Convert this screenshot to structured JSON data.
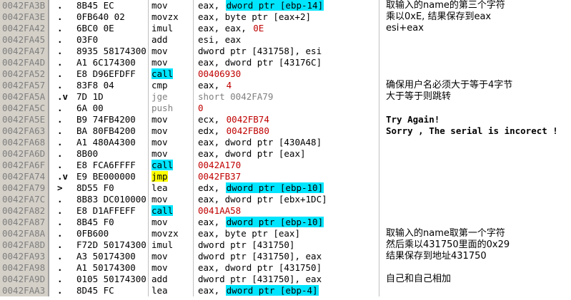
{
  "rows": [
    {
      "addr": "0042FA3B",
      "mark": ".",
      "bytes": "8B45 EC",
      "mnem": "mov",
      "op_pre": "eax, ",
      "op_hl": "dword ptr [ebp-14]",
      "op_post": "",
      "comment": "取输入的name的第三个字符"
    },
    {
      "addr": "0042FA3E",
      "mark": ".",
      "bytes": "0FB640 02",
      "mnem": "movzx",
      "op_pre": "eax, byte ptr [eax+2]",
      "op_hl": "",
      "op_post": "",
      "comment": "乘以0xE, 结果保存到eax"
    },
    {
      "addr": "0042FA42",
      "mark": ".",
      "bytes": "6BC0 0E",
      "mnem": "imul",
      "op_pre": "eax, eax, ",
      "op_red": "0E",
      "comment": "esi+eax"
    },
    {
      "addr": "0042FA45",
      "mark": ".",
      "bytes": "03F0",
      "mnem": "add",
      "op_pre": "esi, eax",
      "comment": ""
    },
    {
      "addr": "0042FA47",
      "mark": ".",
      "bytes": "8935 58174300",
      "mnem": "mov",
      "op_pre": "dword ptr [431758], esi",
      "comment": ""
    },
    {
      "addr": "0042FA4D",
      "mark": ".",
      "bytes": "A1 6C174300",
      "mnem": "mov",
      "op_pre": "eax, dword ptr [43176C]",
      "comment": ""
    },
    {
      "addr": "0042FA52",
      "mark": ".",
      "bytes": "E8 D96EFDFF",
      "mnem": "call",
      "mnem_hl": "cyan",
      "op_red": "00406930",
      "comment": ""
    },
    {
      "addr": "0042FA57",
      "mark": ".",
      "bytes": "83F8 04",
      "mnem": "cmp",
      "op_pre": "eax, ",
      "op_red": "4",
      "comment": "确保用户名必须大于等于4字节"
    },
    {
      "addr": "0042FA5A",
      "mark": ".v",
      "bytes": "7D 1D",
      "mnem": "jge",
      "gray": true,
      "op_pre": "short 0042FA79",
      "comment": "大于等于则跳转"
    },
    {
      "addr": "0042FA5C",
      "mark": ".",
      "bytes": "6A 00",
      "mnem": "push",
      "gray": true,
      "op_red": "0",
      "comment": ""
    },
    {
      "addr": "0042FA5E",
      "mark": ".",
      "bytes": "B9 74FB4200",
      "mnem": "mov",
      "op_pre": "ecx, ",
      "op_red": "0042FB74",
      "comment": "Try Again!",
      "mono": true
    },
    {
      "addr": "0042FA63",
      "mark": ".",
      "bytes": "BA 80FB4200",
      "mnem": "mov",
      "op_pre": "edx, ",
      "op_red": "0042FB80",
      "comment": "Sorry , The serial is incorect !",
      "mono": true
    },
    {
      "addr": "0042FA68",
      "mark": ".",
      "bytes": "A1 480A4300",
      "mnem": "mov",
      "op_pre": "eax, dword ptr [430A48]",
      "comment": ""
    },
    {
      "addr": "0042FA6D",
      "mark": ".",
      "bytes": "8B00",
      "mnem": "mov",
      "op_pre": "eax, dword ptr [eax]",
      "comment": ""
    },
    {
      "addr": "0042FA6F",
      "mark": ".",
      "bytes": "E8 FCA6FFFF",
      "mnem": "call",
      "mnem_hl": "cyan",
      "op_red": "0042A170",
      "comment": ""
    },
    {
      "addr": "0042FA74",
      "mark": ".v",
      "bytes": "E9 BE000000",
      "mnem": "jmp",
      "mnem_hl": "yellow",
      "op_red": "0042FB37",
      "comment": ""
    },
    {
      "addr": "0042FA79",
      "mark": ">",
      "bytes": "8D55 F0",
      "mnem": "lea",
      "op_pre": "edx, ",
      "op_hl": "dword ptr [ebp-10]",
      "comment": ""
    },
    {
      "addr": "0042FA7C",
      "mark": ".",
      "bytes": "8B83 DC010000",
      "mnem": "mov",
      "op_pre": "eax, dword ptr [ebx+1DC]",
      "comment": ""
    },
    {
      "addr": "0042FA82",
      "mark": ".",
      "bytes": "E8 D1AFFEFF",
      "mnem": "call",
      "mnem_hl": "cyan",
      "op_red": "0041AA58",
      "comment": ""
    },
    {
      "addr": "0042FA87",
      "mark": ".",
      "bytes": "8B45 F0",
      "mnem": "mov",
      "op_pre": "eax, ",
      "op_hl": "dword ptr [ebp-10]",
      "comment": ""
    },
    {
      "addr": "0042FA8A",
      "mark": ".",
      "bytes": "0FB600",
      "mnem": "movzx",
      "op_pre": "eax, byte ptr [eax]",
      "comment": "取输入的name取第一个字符"
    },
    {
      "addr": "0042FA8D",
      "mark": ".",
      "bytes": "F72D 50174300",
      "mnem": "imul",
      "op_pre": "dword ptr [431750]",
      "comment": "然后乘以431750里面的0x29"
    },
    {
      "addr": "0042FA93",
      "mark": ".",
      "bytes": "A3 50174300",
      "mnem": "mov",
      "op_pre": "dword ptr [431750], eax",
      "comment": "结果保存到地址431750"
    },
    {
      "addr": "0042FA98",
      "mark": ".",
      "bytes": "A1 50174300",
      "mnem": "mov",
      "op_pre": "eax, dword ptr [431750]",
      "comment": ""
    },
    {
      "addr": "0042FA9D",
      "mark": ".",
      "bytes": "0105 50174300",
      "mnem": "add",
      "op_pre": "dword ptr [431750], eax",
      "comment": "自己和自己相加"
    },
    {
      "addr": "0042FAA3",
      "mark": ".",
      "bytes": "8D45 FC",
      "mnem": "lea",
      "op_pre": "eax, ",
      "op_hl": "dword ptr [ebp-4]",
      "comment": ""
    }
  ]
}
